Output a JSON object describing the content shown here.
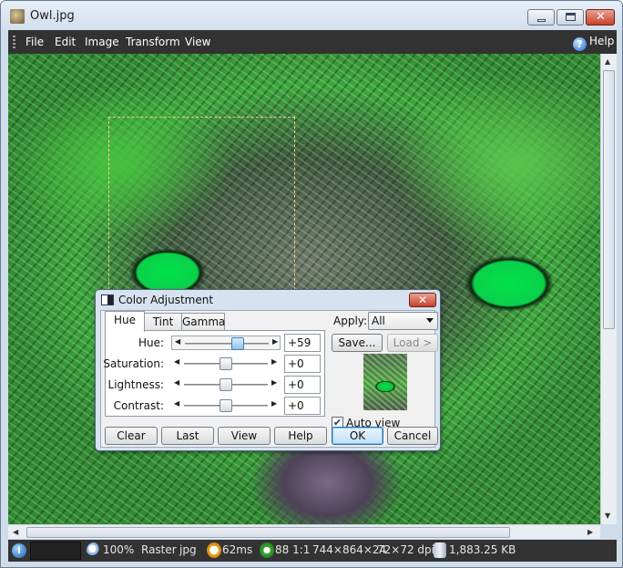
{
  "window": {
    "title": "Owl.jpg"
  },
  "menu": {
    "items": [
      "File",
      "Edit",
      "Image",
      "Transform",
      "View"
    ],
    "help": "Help"
  },
  "statusbar": {
    "zoom": "100%",
    "mode": "Raster",
    "format": "jpg",
    "time": "62ms",
    "color": "88 1:1",
    "size": "744×864×24",
    "dpi": "72×72 dpi",
    "filesize": "1,883.25 KB"
  },
  "dialog": {
    "title": "Color Adjustment",
    "tabs": [
      "Hue",
      "Tint",
      "Gamma"
    ],
    "active_tab": "Hue",
    "rows": [
      {
        "label": "Hue:",
        "value": "+59",
        "level": 0.66
      },
      {
        "label": "Saturation:",
        "value": "+0",
        "level": 0.5
      },
      {
        "label": "Lightness:",
        "value": "+0",
        "level": 0.5
      },
      {
        "label": "Contrast:",
        "value": "+0",
        "level": 0.5
      }
    ],
    "apply_label": "Apply:",
    "apply_value": "All",
    "save_label": "Save...",
    "load_label": "Load >",
    "auto_view_label": "Auto view",
    "auto_view_checked": true,
    "buttons": {
      "clear": "Clear",
      "last": "Last",
      "view": "View",
      "help": "Help",
      "ok": "OK",
      "cancel": "Cancel"
    }
  },
  "icons": {
    "info": "info-icon",
    "zoom": "magnifier-icon",
    "time": "clock-icon",
    "color": "color-depth-icon",
    "disk": "disk-icon"
  }
}
